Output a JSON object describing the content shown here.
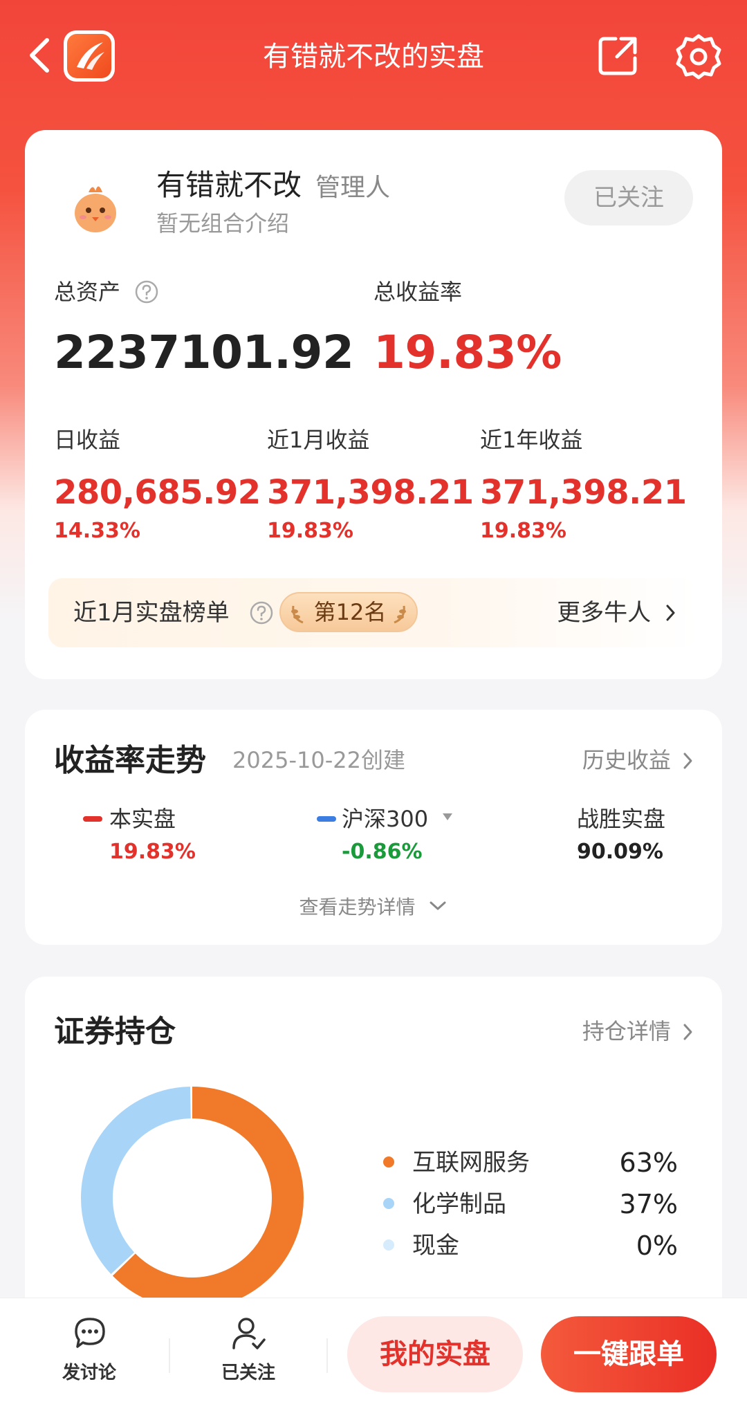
{
  "header": {
    "title": "有错就不改的实盘",
    "icons": {
      "back": "back-arrow-icon",
      "logo": "app-logo-icon",
      "share": "share-icon",
      "settings": "gear-icon"
    }
  },
  "profile": {
    "name": "有错就不改",
    "role": "管理人",
    "intro": "暂无组合介绍",
    "follow_label": "已关注",
    "total_assets_label": "总资产",
    "total_assets_value": "2237101.92",
    "total_return_label": "总收益率",
    "total_return_value": "19.83%",
    "daily": {
      "label": "日收益",
      "value": "280,685.92",
      "pct": "14.33%"
    },
    "month": {
      "label": "近1月收益",
      "value": "371,398.21",
      "pct": "19.83%"
    },
    "year": {
      "label": "近1年收益",
      "value": "371,398.21",
      "pct": "19.83%"
    },
    "rank": {
      "title": "近1月实盘榜单",
      "badge": "第12名",
      "more": "更多牛人"
    }
  },
  "trend": {
    "title": "收益率走势",
    "created": "2025-10-22创建",
    "history_link": "历史收益",
    "series": [
      {
        "name": "本实盘",
        "value": "19.83%",
        "color": "#e3312b"
      },
      {
        "name": "沪深300",
        "value": "-0.86%",
        "color": "#3b7de0",
        "value_color": "#1a9a3a"
      }
    ],
    "beat": {
      "label": "战胜实盘",
      "value": "90.09%"
    },
    "expand": "查看走势详情"
  },
  "holdings": {
    "title": "证券持仓",
    "detail_link": "持仓详情",
    "allocations": [
      {
        "name": "互联网服务",
        "pct": "63%",
        "fraction": 0.63,
        "color": "#f07a2a"
      },
      {
        "name": "化学制品",
        "pct": "37%",
        "fraction": 0.37,
        "color": "#a8d4f8"
      },
      {
        "name": "现金",
        "pct": "0%",
        "fraction": 0,
        "color": "#d6ebfb"
      }
    ]
  },
  "bottom_bar": {
    "discuss": "发讨论",
    "followed": "已关注",
    "my_portfolio": "我的实盘",
    "copy_trade": "一键跟单"
  },
  "colors": {
    "accent": "#e3312b",
    "header_red": "#f2453a",
    "down_green": "#1a9a3a"
  }
}
